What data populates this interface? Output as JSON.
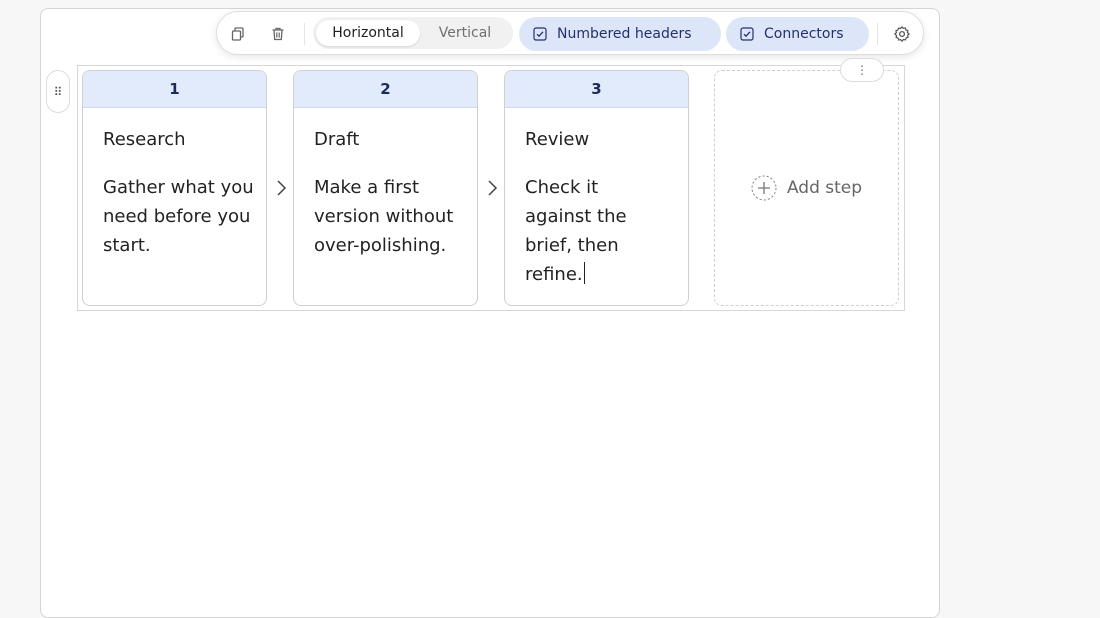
{
  "toolbar": {
    "duplicate_icon": "copy-icon",
    "delete_icon": "trash-icon",
    "layout_options": [
      {
        "label": "Horizontal",
        "selected": true
      },
      {
        "label": "Vertical",
        "selected": false
      }
    ],
    "numbered_headers": {
      "label": "Numbered headers",
      "checked": true
    },
    "connectors": {
      "label": "Connectors",
      "checked": true
    },
    "settings_icon": "gear-icon"
  },
  "steps": [
    {
      "number": "1",
      "title": "Research",
      "description": "Gather what you need before you start."
    },
    {
      "number": "2",
      "title": "Draft",
      "description": "Make a first version without over-polishing."
    },
    {
      "number": "3",
      "title": "Review",
      "description": "Check it against the brief, then refine."
    }
  ],
  "add_step": {
    "label": "Add step",
    "icon": "plus-circle-icon"
  },
  "colors": {
    "header_bg": "#e2ebfb",
    "pill_bg": "#dde6f8",
    "accent_text": "#23306e"
  }
}
